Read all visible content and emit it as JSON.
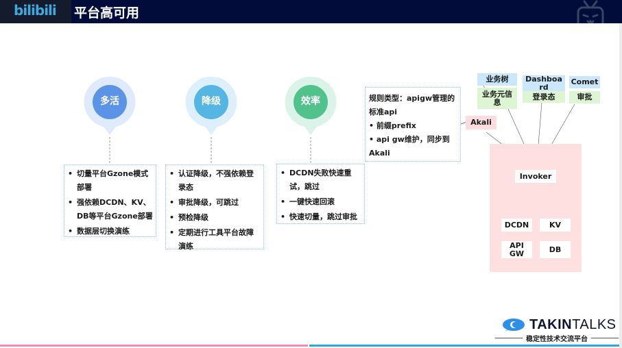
{
  "header": {
    "logo": "bilibili",
    "title": "平台高可用",
    "icon": "tv-mascot-icon"
  },
  "colors": {
    "header_bg": "#010c3a",
    "pin1": "#5b93e6",
    "pin2": "#55b6e4",
    "pin3": "#52c28d",
    "bar_pink": "#f58ab1",
    "bar_blue": "#29a9e0"
  },
  "pillars": [
    {
      "label": "多活",
      "items": [
        "切量平台Gzone模式部署",
        "强依赖DCDN、KV、DB等平台Gzone部署",
        "数据层切换演练"
      ]
    },
    {
      "label": "降级",
      "items": [
        "认证降级，不强依赖登录态",
        "审批降级，可跳过",
        "预检降级",
        "定期进行工具平台故障演练"
      ]
    },
    {
      "label": "效率",
      "items": [
        "DCDN失败快速重试，跳过",
        "一键快速回滚",
        "快速切量，跳过审批"
      ]
    }
  ],
  "rule_card": {
    "title": "规则类型：apigw管理的标准api",
    "items": [
      "前缀prefix",
      "api gw维护，同步到Akali"
    ]
  },
  "diagram": {
    "sources": [
      {
        "top": "业务树",
        "bottom": "业务元信息"
      },
      {
        "top": "Dashboard",
        "bottom": "登录态"
      },
      {
        "top": "Comet",
        "bottom": "审批"
      }
    ],
    "akali": "Akali",
    "invoker": "Invoker",
    "targets": [
      "DCDN",
      "KV",
      "API GW",
      "DB"
    ]
  },
  "footer": {
    "brand_bold": "TAKIN",
    "brand_light": "TALKS",
    "slogan": "稳定性技术交流平台"
  }
}
